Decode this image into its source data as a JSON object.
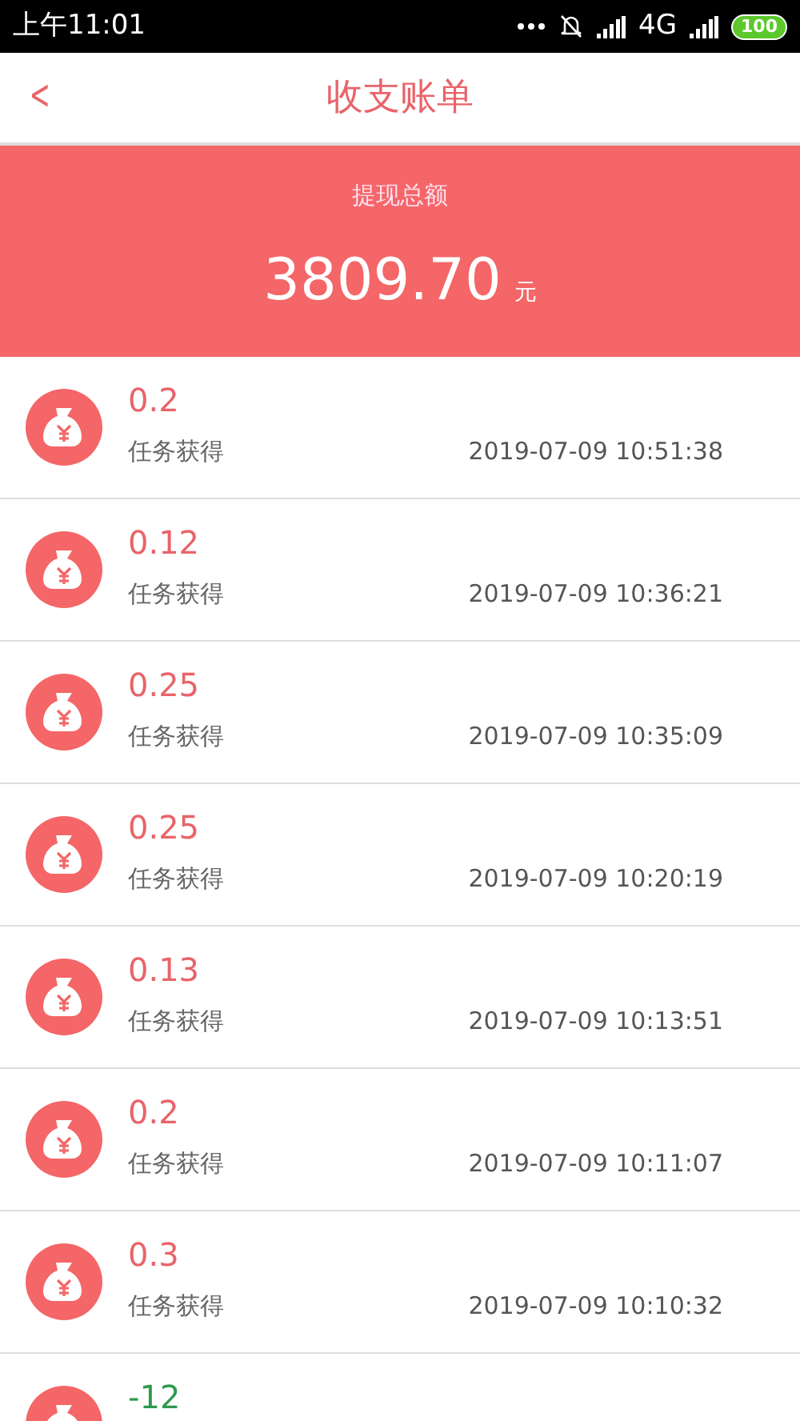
{
  "status_bar": {
    "time": "上午11:01",
    "network": "4G",
    "battery": "100"
  },
  "header": {
    "back": "<",
    "title": "收支账单"
  },
  "summary": {
    "label": "提现总额",
    "amount": "3809.70",
    "unit": "元"
  },
  "records": [
    {
      "amount": "0.2",
      "kind": "income",
      "source": "任务获得",
      "time": "2019-07-09 10:51:38"
    },
    {
      "amount": "0.12",
      "kind": "income",
      "source": "任务获得",
      "time": "2019-07-09 10:36:21"
    },
    {
      "amount": "0.25",
      "kind": "income",
      "source": "任务获得",
      "time": "2019-07-09 10:35:09"
    },
    {
      "amount": "0.25",
      "kind": "income",
      "source": "任务获得",
      "time": "2019-07-09 10:20:19"
    },
    {
      "amount": "0.13",
      "kind": "income",
      "source": "任务获得",
      "time": "2019-07-09 10:13:51"
    },
    {
      "amount": "0.2",
      "kind": "income",
      "source": "任务获得",
      "time": "2019-07-09 10:11:07"
    },
    {
      "amount": "0.3",
      "kind": "income",
      "source": "任务获得",
      "time": "2019-07-09 10:10:32"
    },
    {
      "amount": "-12",
      "kind": "expense"
    }
  ]
}
